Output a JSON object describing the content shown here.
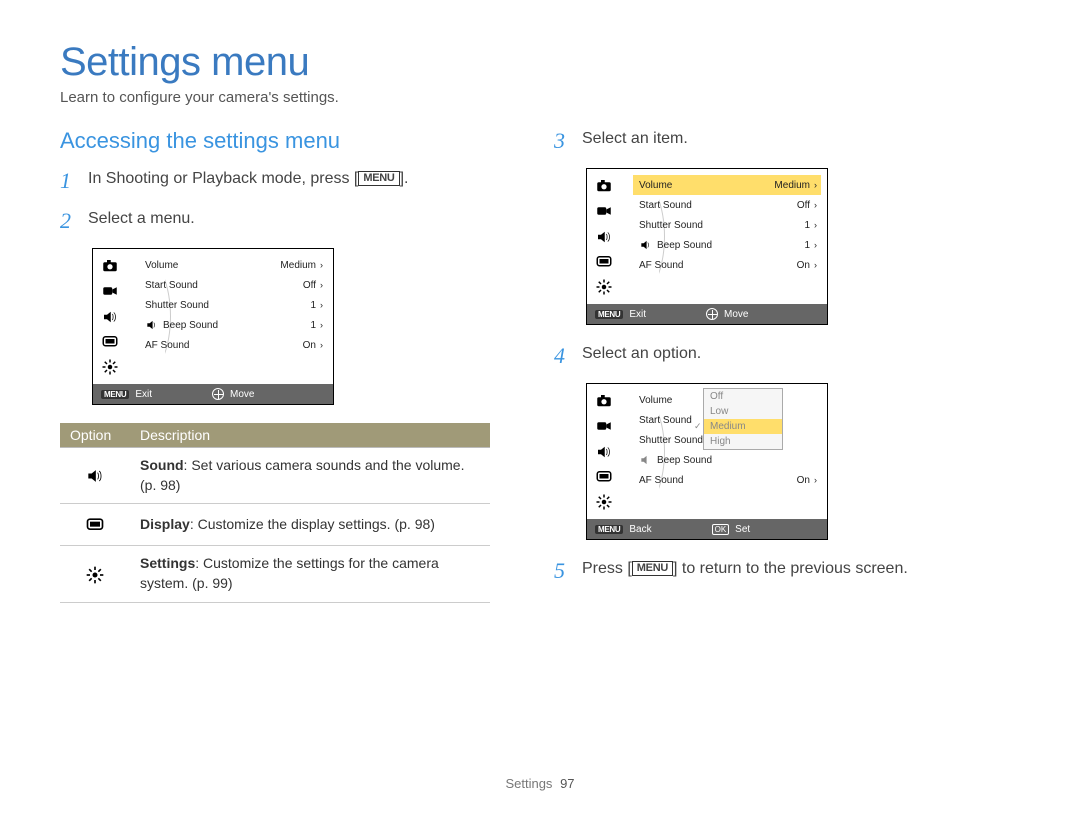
{
  "title": "Settings menu",
  "subtitle": "Learn to configure your camera's settings.",
  "section_heading": "Accessing the settings menu",
  "menu_label": "MENU",
  "steps": {
    "s1_pre": "In Shooting or Playback mode, press [",
    "s1_post": "].",
    "s2": "Select a menu.",
    "s3": "Select an item.",
    "s4": "Select an option.",
    "s5_pre": "Press [",
    "s5_post": "] to return to the previous screen."
  },
  "step_numbers": {
    "n1": "1",
    "n2": "2",
    "n3": "3",
    "n4": "4",
    "n5": "5"
  },
  "menu_rows": [
    {
      "label": "Volume",
      "value": "Medium"
    },
    {
      "label": "Start Sound",
      "value": "Off"
    },
    {
      "label": "Shutter Sound",
      "value": "1"
    },
    {
      "label": "Beep Sound",
      "value": "1"
    },
    {
      "label": "AF Sound",
      "value": "On"
    }
  ],
  "screen_a_foot": {
    "left_label": "Exit",
    "right_label": "Move"
  },
  "screen_b_foot": {
    "left_label": "Exit",
    "right_label": "Move"
  },
  "screen_c_foot": {
    "left_label": "Back",
    "right_label": "Set"
  },
  "option_popup": [
    {
      "label": "Off",
      "selected": false
    },
    {
      "label": "Low",
      "selected": false
    },
    {
      "label": "Medium",
      "selected": true
    },
    {
      "label": "High",
      "selected": false
    }
  ],
  "opt_table": {
    "head_option": "Option",
    "head_desc": "Description",
    "rows": [
      {
        "bold": "Sound",
        "desc": ": Set various camera sounds and the volume. (p. 98)"
      },
      {
        "bold": "Display",
        "desc": ": Customize the display settings. (p. 98)"
      },
      {
        "bold": "Settings",
        "desc": ": Customize the settings for the camera system. (p. 99)"
      }
    ]
  },
  "footer": {
    "section": "Settings",
    "page": "97"
  },
  "screen_c_af": {
    "label": "AF Sound",
    "value": "On"
  }
}
